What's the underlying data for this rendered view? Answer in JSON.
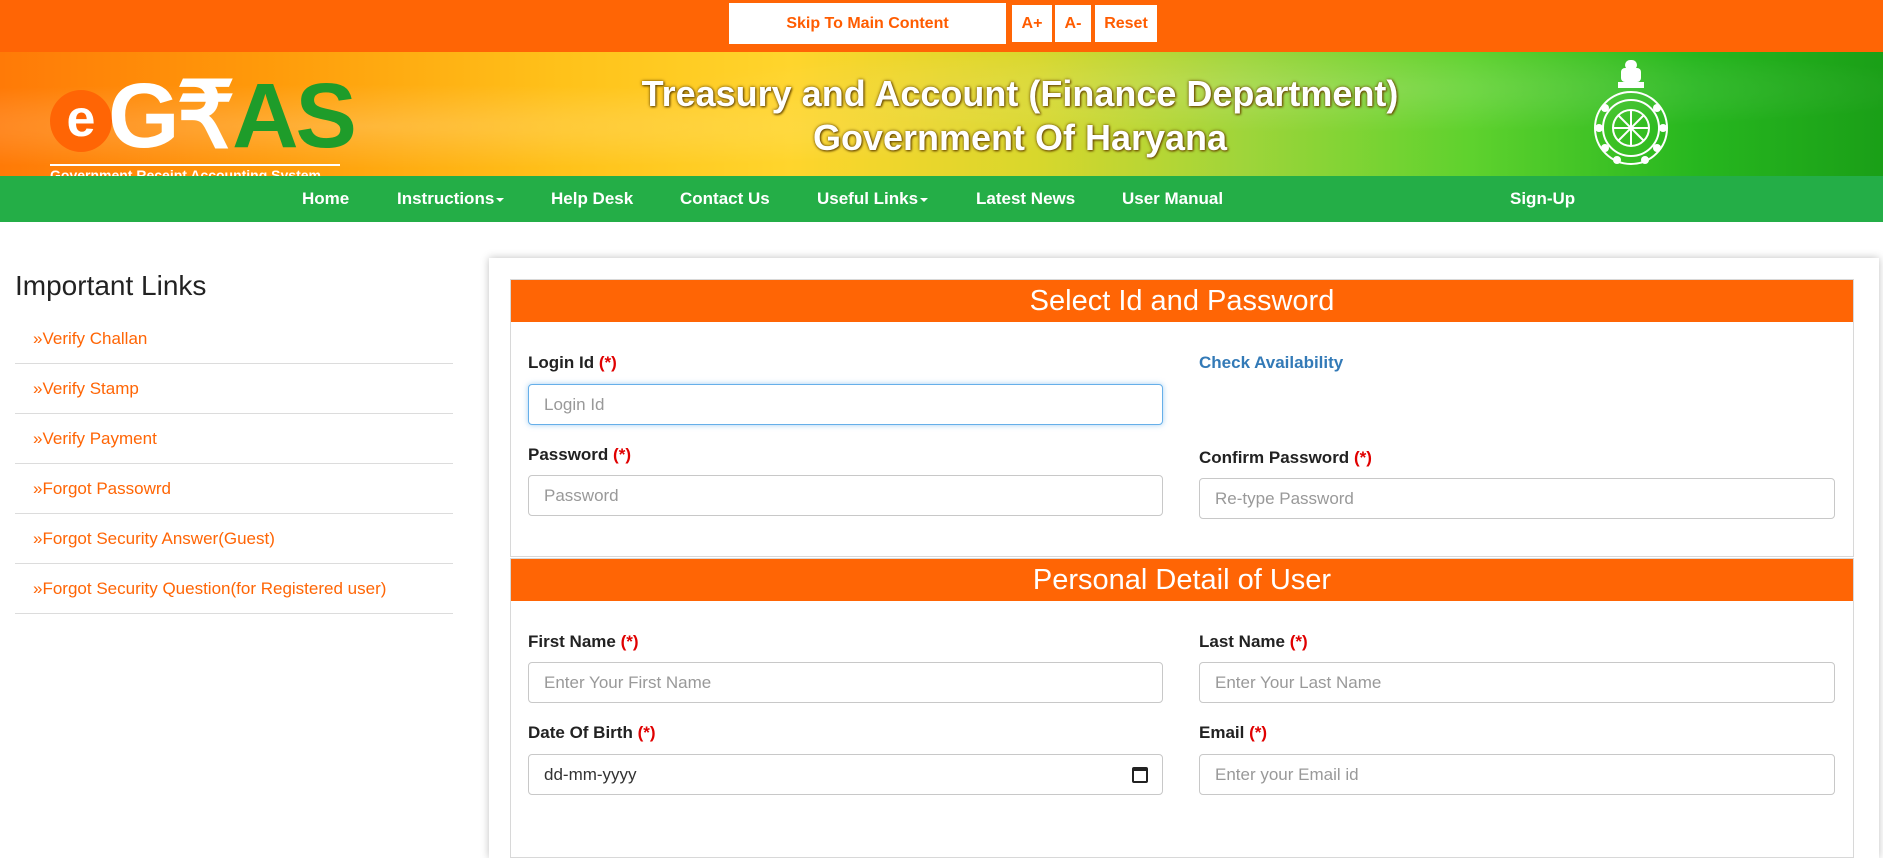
{
  "accessibility": {
    "skip_label": "Skip To Main Content",
    "increase_label": "A+",
    "decrease_label": "A-",
    "reset_label": "Reset"
  },
  "banner": {
    "logo_letter": "e",
    "logo_g": "G",
    "logo_r": "₹",
    "logo_as": "AS",
    "logo_tagline": "Government Receipt Accounting System",
    "title_line1": "Treasury and Account (Finance Department)",
    "title_line2": "Government Of Haryana"
  },
  "nav": {
    "home": "Home",
    "instructions": "Instructions",
    "help_desk": "Help Desk",
    "contact_us": "Contact Us",
    "useful_links": "Useful Links",
    "latest_news": "Latest News",
    "user_manual": "User Manual",
    "sign_up": "Sign-Up"
  },
  "sidebar": {
    "title": "Important Links",
    "chevron": "»",
    "items": [
      "Verify Challan",
      "Verify Stamp",
      "Verify Payment",
      "Forgot Passowrd",
      "Forgot Security Answer(Guest)",
      "Forgot Security Question(for Registered user)"
    ]
  },
  "form": {
    "required_mark": "(*)",
    "section1_title": "Select Id and Password",
    "login_id_label": "Login Id",
    "login_id_placeholder": "Login Id",
    "check_availability": "Check Availability",
    "password_label": "Password",
    "password_placeholder": "Password",
    "confirm_password_label": "Confirm Password",
    "confirm_password_placeholder": "Re-type Password",
    "section2_title": "Personal Detail of User",
    "first_name_label": "First Name",
    "first_name_placeholder": "Enter Your First Name",
    "last_name_label": "Last Name",
    "last_name_placeholder": "Enter Your Last Name",
    "dob_label": "Date Of Birth",
    "dob_value": "dd-mm-yyyy",
    "email_label": "Email",
    "email_placeholder": "Enter your Email id"
  }
}
